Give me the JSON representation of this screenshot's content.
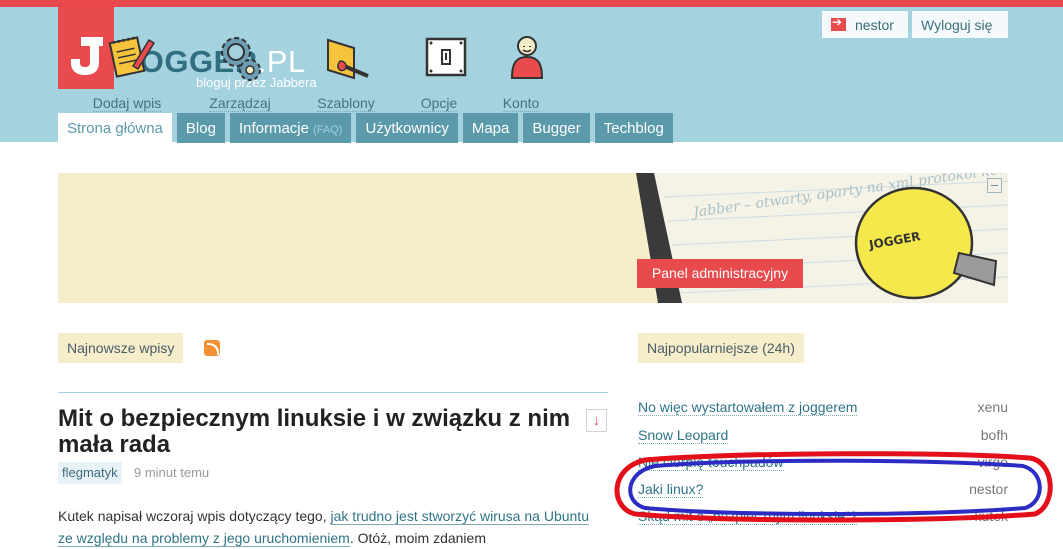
{
  "header": {
    "logo_main": "JOGGER",
    "logo_suffix": ".PL",
    "tagline": "bloguj przez Jabbera",
    "user": "nestor",
    "logout": "Wyloguj się"
  },
  "nav": [
    {
      "label": "Strona główna",
      "active": true
    },
    {
      "label": "Blog"
    },
    {
      "label": "Informacje",
      "extra": "(FAQ)"
    },
    {
      "label": "Użytkownicy"
    },
    {
      "label": "Mapa"
    },
    {
      "label": "Bugger"
    },
    {
      "label": "Techblog"
    }
  ],
  "tools": [
    "Dodaj wpis",
    "Zarządzaj",
    "Szablony",
    "Opcje",
    "Konto"
  ],
  "admin_panel_button": "Panel administracyjny",
  "sections": {
    "newest": "Najnowsze wpisy",
    "popular": "Najpopularniejsze (24h)"
  },
  "post": {
    "title": "Mit o bezpiecznym linuksie i w związku z nim mała rada",
    "author": "flegmatyk",
    "time": "9 minut temu",
    "body_before": "Kutek napisał wczoraj wpis dotyczący tego, ",
    "body_link": "jak trudno jest stworzyć wirusa na Ubuntu ze względu na problemy z jego uruchomieniem",
    "body_after": ". Otóż, moim zdaniem"
  },
  "popular": [
    {
      "title": "No więc wystartowałem z joggerem",
      "user": "xenu"
    },
    {
      "title": "Snow Leopard",
      "user": "bofh"
    },
    {
      "title": "Nie cierpię touchpadów",
      "user": "virgo"
    },
    {
      "title": "Jaki linux?",
      "user": "nestor"
    },
    {
      "title": "Skąd mit o „bezpiecznym linuksie”?",
      "user": "kutek"
    }
  ],
  "illustration_text": "Jabber – otwarty, oparty na xml protokół komunikacji ... szybki, wygodny, ... otwórz swojej",
  "illustration_bulb_text": "JOGGER",
  "colors": {
    "brand_red": "#e84a4d",
    "header_blue": "#a4d2df",
    "tab_blue": "#5a9aaa",
    "panel_beige": "#f6edcb",
    "annotation_red": "#e3101b",
    "annotation_blue": "#2c2cc4"
  }
}
